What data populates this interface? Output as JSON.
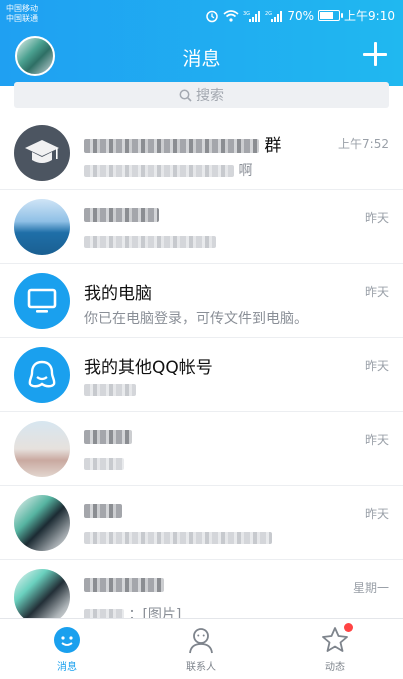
{
  "status_bar": {
    "carrier_1": "中国移动",
    "carrier_2": "中国联通",
    "battery": "70%",
    "time": "上午9:10"
  },
  "header": {
    "title": "消息"
  },
  "search": {
    "placeholder": "搜索"
  },
  "conversations": [
    {
      "name_suffix": "群",
      "message_suffix": "啊",
      "time": "上午7:52",
      "avatar": "graduation-cap-icon"
    },
    {
      "name_suffix": "",
      "message_suffix": "",
      "time": "昨天",
      "avatar": "sea-photo"
    },
    {
      "name": "我的电脑",
      "message": "你已在电脑登录，可传文件到电脑。",
      "time": "昨天",
      "avatar": "monitor-icon"
    },
    {
      "name": "我的其他QQ帐号",
      "message_suffix": "",
      "time": "昨天",
      "avatar": "other-accounts-icon"
    },
    {
      "name_suffix": "",
      "message_suffix": "",
      "time": "昨天",
      "avatar": "beach-photo"
    },
    {
      "name_suffix": "",
      "message_suffix": "",
      "time": "昨天",
      "avatar": "bag-photo"
    },
    {
      "name_suffix": "",
      "message_suffix": "：[图片]",
      "time": "星期一",
      "avatar": "bag-photo"
    }
  ],
  "tabs": [
    {
      "label": "消息",
      "active": true,
      "icon": "message-icon"
    },
    {
      "label": "联系人",
      "active": false,
      "icon": "contact-icon"
    },
    {
      "label": "动态",
      "active": false,
      "icon": "star-icon",
      "badge": true
    }
  ],
  "colors": {
    "accent": "#1aa0ee",
    "header_start": "#1fa0f2",
    "header_end": "#20b8f0",
    "badge": "#ff4444"
  }
}
